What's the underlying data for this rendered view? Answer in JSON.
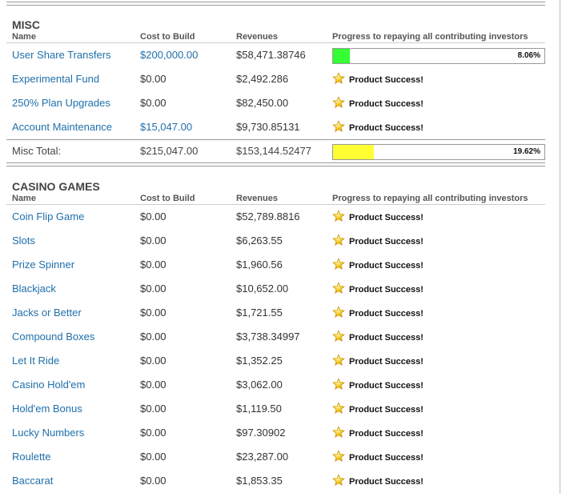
{
  "columns": {
    "name": "Name",
    "cost": "Cost to Build",
    "revenue": "Revenues",
    "progress": "Progress to repaying all contributing investors"
  },
  "success_text": "Product Success!",
  "colors": {
    "link": "#1f6faa",
    "bar_green": "#33ff33",
    "bar_yellow": "#ffff33"
  },
  "misc": {
    "title": "MISC",
    "rows": [
      {
        "name": "User Share Transfers",
        "cost": "$200,000.00",
        "revenue": "$58,471.38746",
        "progress": "8.06%",
        "progress_value": 8.06,
        "cost_is_link": true
      },
      {
        "name": "Experimental Fund",
        "cost": "$0.00",
        "revenue": "$2,492.286"
      },
      {
        "name": "250% Plan Upgrades",
        "cost": "$0.00",
        "revenue": "$82,450.00"
      },
      {
        "name": "Account Maintenance",
        "cost": "$15,047.00",
        "revenue": "$9,730.85131",
        "cost_is_link": true
      }
    ],
    "total": {
      "label": "Misc Total:",
      "cost": "$215,047.00",
      "revenue": "$153,144.52477",
      "progress": "19.62%",
      "progress_value": 19.62
    }
  },
  "casino": {
    "title": "CASINO GAMES",
    "rows": [
      {
        "name": "Coin Flip Game",
        "cost": "$0.00",
        "revenue": "$52,789.8816"
      },
      {
        "name": "Slots",
        "cost": "$0.00",
        "revenue": "$6,263.55"
      },
      {
        "name": "Prize Spinner",
        "cost": "$0.00",
        "revenue": "$1,960.56"
      },
      {
        "name": "Blackjack",
        "cost": "$0.00",
        "revenue": "$10,652.00"
      },
      {
        "name": "Jacks or Better",
        "cost": "$0.00",
        "revenue": "$1,721.55"
      },
      {
        "name": "Compound Boxes",
        "cost": "$0.00",
        "revenue": "$3,738.34997"
      },
      {
        "name": "Let It Ride",
        "cost": "$0.00",
        "revenue": "$1,352.25"
      },
      {
        "name": "Casino Hold'em",
        "cost": "$0.00",
        "revenue": "$3,062.00"
      },
      {
        "name": "Hold'em Bonus",
        "cost": "$0.00",
        "revenue": "$1,119.50"
      },
      {
        "name": "Lucky Numbers",
        "cost": "$0.00",
        "revenue": "$97.30902"
      },
      {
        "name": "Roulette",
        "cost": "$0.00",
        "revenue": "$23,287.00"
      },
      {
        "name": "Baccarat",
        "cost": "$0.00",
        "revenue": "$1,853.35"
      }
    ]
  }
}
